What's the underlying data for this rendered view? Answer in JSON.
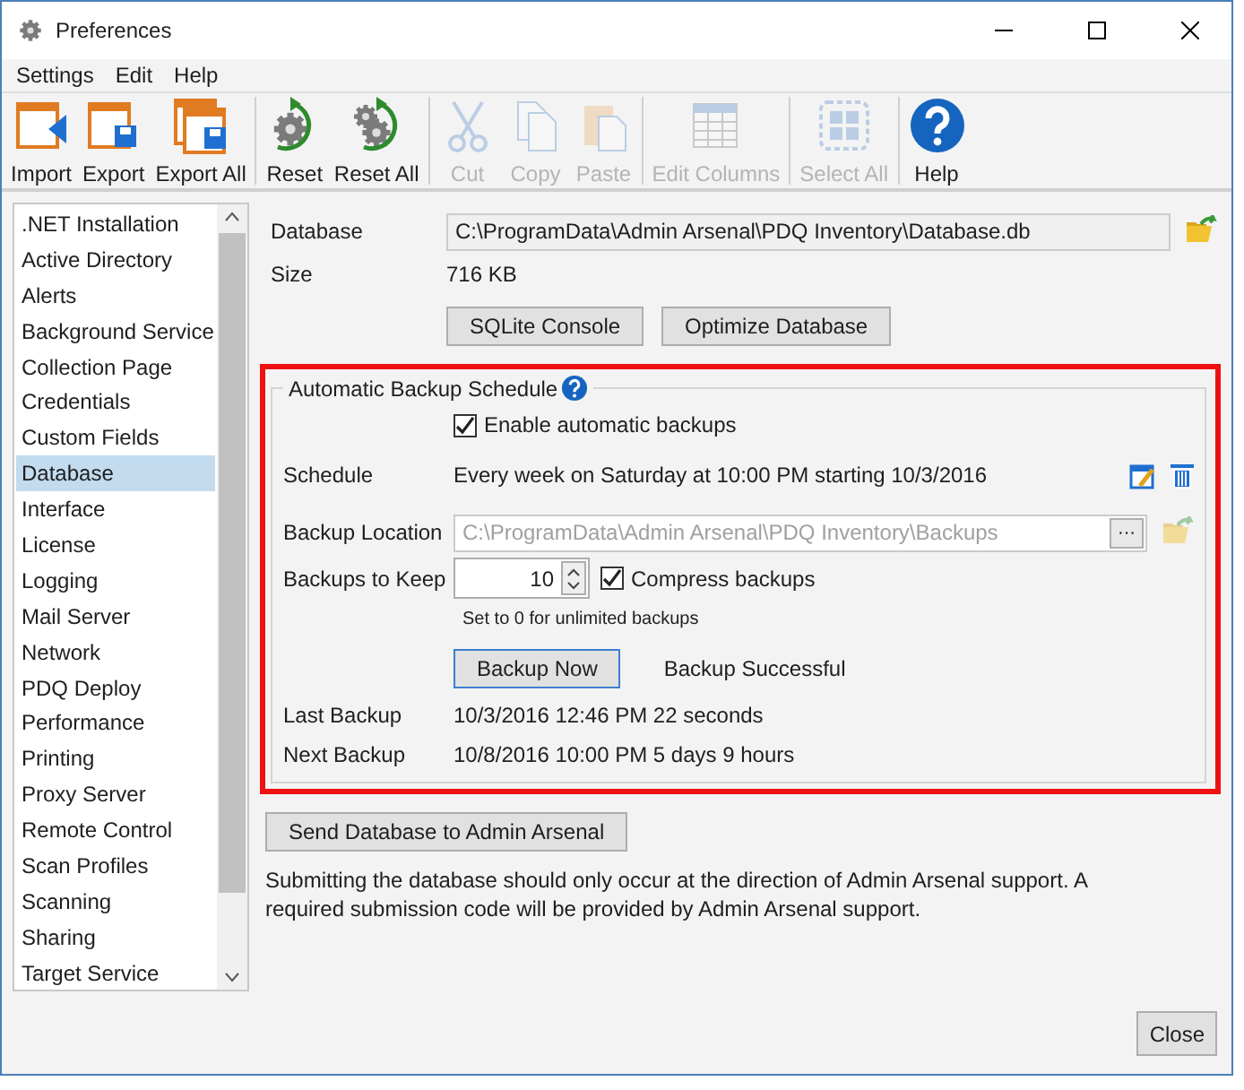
{
  "window": {
    "title": "Preferences"
  },
  "menu": [
    "Settings",
    "Edit",
    "Help"
  ],
  "toolbar": [
    {
      "items": [
        {
          "label": "Import",
          "disabled": false
        },
        {
          "label": "Export",
          "disabled": false
        },
        {
          "label": "Export All",
          "disabled": false
        }
      ]
    },
    {
      "items": [
        {
          "label": "Reset",
          "disabled": false
        },
        {
          "label": "Reset All",
          "disabled": false
        }
      ]
    },
    {
      "items": [
        {
          "label": "Cut",
          "disabled": true
        },
        {
          "label": "Copy",
          "disabled": true
        },
        {
          "label": "Paste",
          "disabled": true
        }
      ]
    },
    {
      "items": [
        {
          "label": "Edit Columns",
          "disabled": true
        }
      ]
    },
    {
      "items": [
        {
          "label": "Select All",
          "disabled": true
        }
      ]
    },
    {
      "items": [
        {
          "label": "Help",
          "disabled": false
        }
      ]
    }
  ],
  "sidebar": {
    "items": [
      {
        "label": ".NET Installation",
        "selected": false
      },
      {
        "label": "Active Directory",
        "selected": false
      },
      {
        "label": "Alerts",
        "selected": false
      },
      {
        "label": "Background Service",
        "selected": false
      },
      {
        "label": "Collection Page",
        "selected": false
      },
      {
        "label": "Credentials",
        "selected": false
      },
      {
        "label": "Custom Fields",
        "selected": false
      },
      {
        "label": "Database",
        "selected": true
      },
      {
        "label": "Interface",
        "selected": false
      },
      {
        "label": "License",
        "selected": false
      },
      {
        "label": "Logging",
        "selected": false
      },
      {
        "label": "Mail Server",
        "selected": false
      },
      {
        "label": "Network",
        "selected": false
      },
      {
        "label": "PDQ Deploy",
        "selected": false
      },
      {
        "label": "Performance",
        "selected": false
      },
      {
        "label": "Printing",
        "selected": false
      },
      {
        "label": "Proxy Server",
        "selected": false
      },
      {
        "label": "Remote Control",
        "selected": false
      },
      {
        "label": "Scan Profiles",
        "selected": false
      },
      {
        "label": "Scanning",
        "selected": false
      },
      {
        "label": "Sharing",
        "selected": false
      },
      {
        "label": "Target Service",
        "selected": false
      }
    ]
  },
  "database": {
    "label": "Database",
    "path": "C:\\ProgramData\\Admin Arsenal\\PDQ Inventory\\Database.db",
    "size_label": "Size",
    "size": "716 KB",
    "buttons": [
      "SQLite Console",
      "Optimize Database"
    ]
  },
  "backup": {
    "highlighted": true,
    "title": "Automatic Backup Schedule",
    "enable": {
      "label": "Enable automatic backups",
      "checked": true
    },
    "schedule_label": "Schedule",
    "schedule": "Every week on Saturday at 10:00 PM starting 10/3/2016",
    "location": {
      "label": "Backup Location",
      "value": "C:\\ProgramData\\Admin Arsenal\\PDQ Inventory\\Backups",
      "disabled": true,
      "browse": "···"
    },
    "keep_label": "Backups to Keep",
    "keep": "10",
    "compress": {
      "label": "Compress backups",
      "checked": true
    },
    "hint": "Set to 0 for unlimited backups",
    "backup_button": "Backup Now",
    "status": "Backup Successful",
    "last_label": "Last Backup",
    "last": "10/3/2016 12:46 PM 22 seconds",
    "next_label": "Next Backup",
    "next": "10/8/2016 10:00 PM 5 days 9 hours"
  },
  "send_button": "Send Database to Admin Arsenal",
  "note": "Submitting the database should only occur at the direction of Admin Arsenal support. A required submission code will be provided by Admin Arsenal support.",
  "close_button": "Close"
}
